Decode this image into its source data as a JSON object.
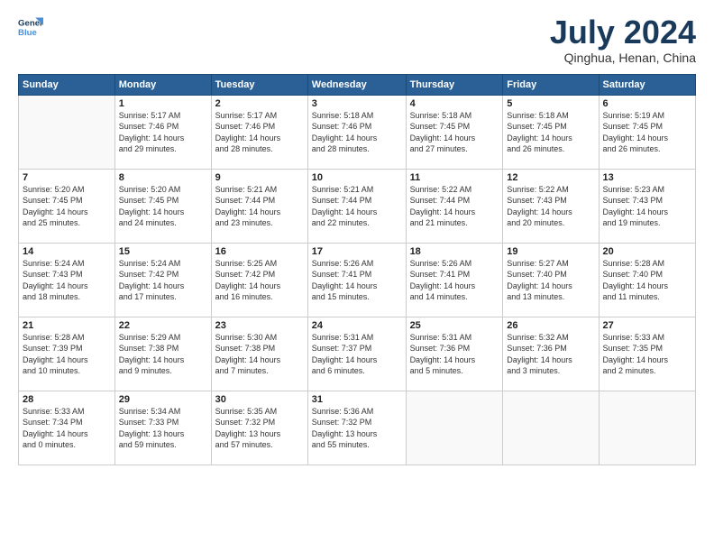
{
  "logo": {
    "line1": "General",
    "line2": "Blue"
  },
  "title": "July 2024",
  "subtitle": "Qinghua, Henan, China",
  "headers": [
    "Sunday",
    "Monday",
    "Tuesday",
    "Wednesday",
    "Thursday",
    "Friday",
    "Saturday"
  ],
  "weeks": [
    [
      {
        "day": "",
        "info": ""
      },
      {
        "day": "1",
        "info": "Sunrise: 5:17 AM\nSunset: 7:46 PM\nDaylight: 14 hours\nand 29 minutes."
      },
      {
        "day": "2",
        "info": "Sunrise: 5:17 AM\nSunset: 7:46 PM\nDaylight: 14 hours\nand 28 minutes."
      },
      {
        "day": "3",
        "info": "Sunrise: 5:18 AM\nSunset: 7:46 PM\nDaylight: 14 hours\nand 28 minutes."
      },
      {
        "day": "4",
        "info": "Sunrise: 5:18 AM\nSunset: 7:45 PM\nDaylight: 14 hours\nand 27 minutes."
      },
      {
        "day": "5",
        "info": "Sunrise: 5:18 AM\nSunset: 7:45 PM\nDaylight: 14 hours\nand 26 minutes."
      },
      {
        "day": "6",
        "info": "Sunrise: 5:19 AM\nSunset: 7:45 PM\nDaylight: 14 hours\nand 26 minutes."
      }
    ],
    [
      {
        "day": "7",
        "info": "Sunrise: 5:20 AM\nSunset: 7:45 PM\nDaylight: 14 hours\nand 25 minutes."
      },
      {
        "day": "8",
        "info": "Sunrise: 5:20 AM\nSunset: 7:45 PM\nDaylight: 14 hours\nand 24 minutes."
      },
      {
        "day": "9",
        "info": "Sunrise: 5:21 AM\nSunset: 7:44 PM\nDaylight: 14 hours\nand 23 minutes."
      },
      {
        "day": "10",
        "info": "Sunrise: 5:21 AM\nSunset: 7:44 PM\nDaylight: 14 hours\nand 22 minutes."
      },
      {
        "day": "11",
        "info": "Sunrise: 5:22 AM\nSunset: 7:44 PM\nDaylight: 14 hours\nand 21 minutes."
      },
      {
        "day": "12",
        "info": "Sunrise: 5:22 AM\nSunset: 7:43 PM\nDaylight: 14 hours\nand 20 minutes."
      },
      {
        "day": "13",
        "info": "Sunrise: 5:23 AM\nSunset: 7:43 PM\nDaylight: 14 hours\nand 19 minutes."
      }
    ],
    [
      {
        "day": "14",
        "info": "Sunrise: 5:24 AM\nSunset: 7:43 PM\nDaylight: 14 hours\nand 18 minutes."
      },
      {
        "day": "15",
        "info": "Sunrise: 5:24 AM\nSunset: 7:42 PM\nDaylight: 14 hours\nand 17 minutes."
      },
      {
        "day": "16",
        "info": "Sunrise: 5:25 AM\nSunset: 7:42 PM\nDaylight: 14 hours\nand 16 minutes."
      },
      {
        "day": "17",
        "info": "Sunrise: 5:26 AM\nSunset: 7:41 PM\nDaylight: 14 hours\nand 15 minutes."
      },
      {
        "day": "18",
        "info": "Sunrise: 5:26 AM\nSunset: 7:41 PM\nDaylight: 14 hours\nand 14 minutes."
      },
      {
        "day": "19",
        "info": "Sunrise: 5:27 AM\nSunset: 7:40 PM\nDaylight: 14 hours\nand 13 minutes."
      },
      {
        "day": "20",
        "info": "Sunrise: 5:28 AM\nSunset: 7:40 PM\nDaylight: 14 hours\nand 11 minutes."
      }
    ],
    [
      {
        "day": "21",
        "info": "Sunrise: 5:28 AM\nSunset: 7:39 PM\nDaylight: 14 hours\nand 10 minutes."
      },
      {
        "day": "22",
        "info": "Sunrise: 5:29 AM\nSunset: 7:38 PM\nDaylight: 14 hours\nand 9 minutes."
      },
      {
        "day": "23",
        "info": "Sunrise: 5:30 AM\nSunset: 7:38 PM\nDaylight: 14 hours\nand 7 minutes."
      },
      {
        "day": "24",
        "info": "Sunrise: 5:31 AM\nSunset: 7:37 PM\nDaylight: 14 hours\nand 6 minutes."
      },
      {
        "day": "25",
        "info": "Sunrise: 5:31 AM\nSunset: 7:36 PM\nDaylight: 14 hours\nand 5 minutes."
      },
      {
        "day": "26",
        "info": "Sunrise: 5:32 AM\nSunset: 7:36 PM\nDaylight: 14 hours\nand 3 minutes."
      },
      {
        "day": "27",
        "info": "Sunrise: 5:33 AM\nSunset: 7:35 PM\nDaylight: 14 hours\nand 2 minutes."
      }
    ],
    [
      {
        "day": "28",
        "info": "Sunrise: 5:33 AM\nSunset: 7:34 PM\nDaylight: 14 hours\nand 0 minutes."
      },
      {
        "day": "29",
        "info": "Sunrise: 5:34 AM\nSunset: 7:33 PM\nDaylight: 13 hours\nand 59 minutes."
      },
      {
        "day": "30",
        "info": "Sunrise: 5:35 AM\nSunset: 7:32 PM\nDaylight: 13 hours\nand 57 minutes."
      },
      {
        "day": "31",
        "info": "Sunrise: 5:36 AM\nSunset: 7:32 PM\nDaylight: 13 hours\nand 55 minutes."
      },
      {
        "day": "",
        "info": ""
      },
      {
        "day": "",
        "info": ""
      },
      {
        "day": "",
        "info": ""
      }
    ]
  ]
}
